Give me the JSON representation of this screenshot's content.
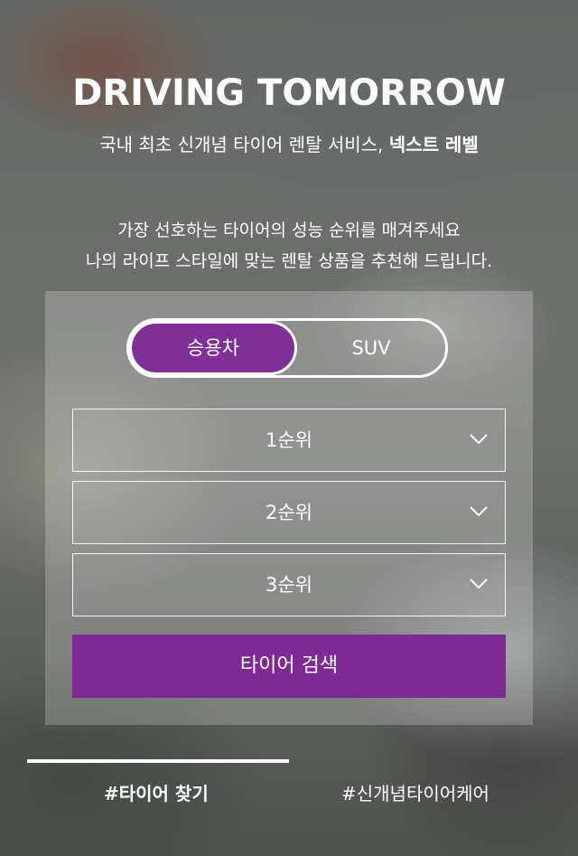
{
  "hero": {
    "title": "DRIVING TOMORROW",
    "subtitle_prefix": "국내 최초 신개념 타이어 렌탈 서비스, ",
    "subtitle_brand": "넥스트 레벨"
  },
  "intro": {
    "line1": "가장 선호하는 타이어의 성능 순위를 매겨주세요",
    "line2": "나의 라이프 스타일에 맞는 렌탈 상품을 추천해 드립니다."
  },
  "vehicle_toggle": {
    "options": [
      "승용차",
      "SUV"
    ],
    "selected": "승용차"
  },
  "rank_selects": [
    {
      "value": "1순위",
      "icon": "chevron-down-icon"
    },
    {
      "value": "2순위",
      "icon": "chevron-down-icon"
    },
    {
      "value": "3순위",
      "icon": "chevron-down-icon"
    }
  ],
  "search_button": {
    "label": "타이어 검색"
  },
  "bottom_tabs": [
    {
      "label": "#타이어 찾기",
      "active": true
    },
    {
      "label": "#신개념타이어케어",
      "active": false
    }
  ],
  "colors": {
    "accent": "#7f2a94",
    "text": "#ffffff"
  }
}
